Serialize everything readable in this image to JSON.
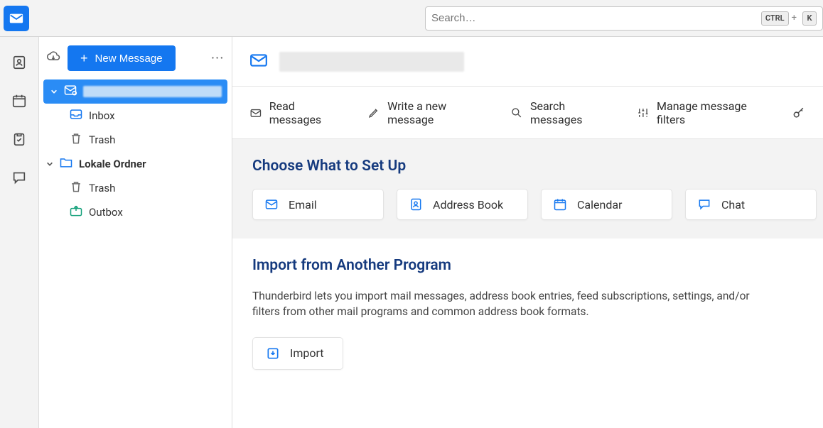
{
  "search": {
    "placeholder": "Search…",
    "kbd1": "CTRL",
    "kbd_sep": "+",
    "kbd2": "K"
  },
  "compose": {
    "label": "New Message"
  },
  "folders": {
    "inbox": "Inbox",
    "trash": "Trash",
    "local_label": "Lokale Ordner",
    "local_trash": "Trash",
    "outbox": "Outbox"
  },
  "actions": {
    "read": "Read messages",
    "write": "Write a new message",
    "search": "Search messages",
    "filters": "Manage message filters"
  },
  "setup": {
    "heading": "Choose What to Set Up",
    "email": "Email",
    "address_book": "Address Book",
    "calendar": "Calendar",
    "chat": "Chat"
  },
  "import": {
    "heading": "Import from Another Program",
    "body": "Thunderbird lets you import mail messages, address book entries, feed subscriptions, settings, and/or filters from other mail programs and common address book formats.",
    "button": "Import"
  }
}
